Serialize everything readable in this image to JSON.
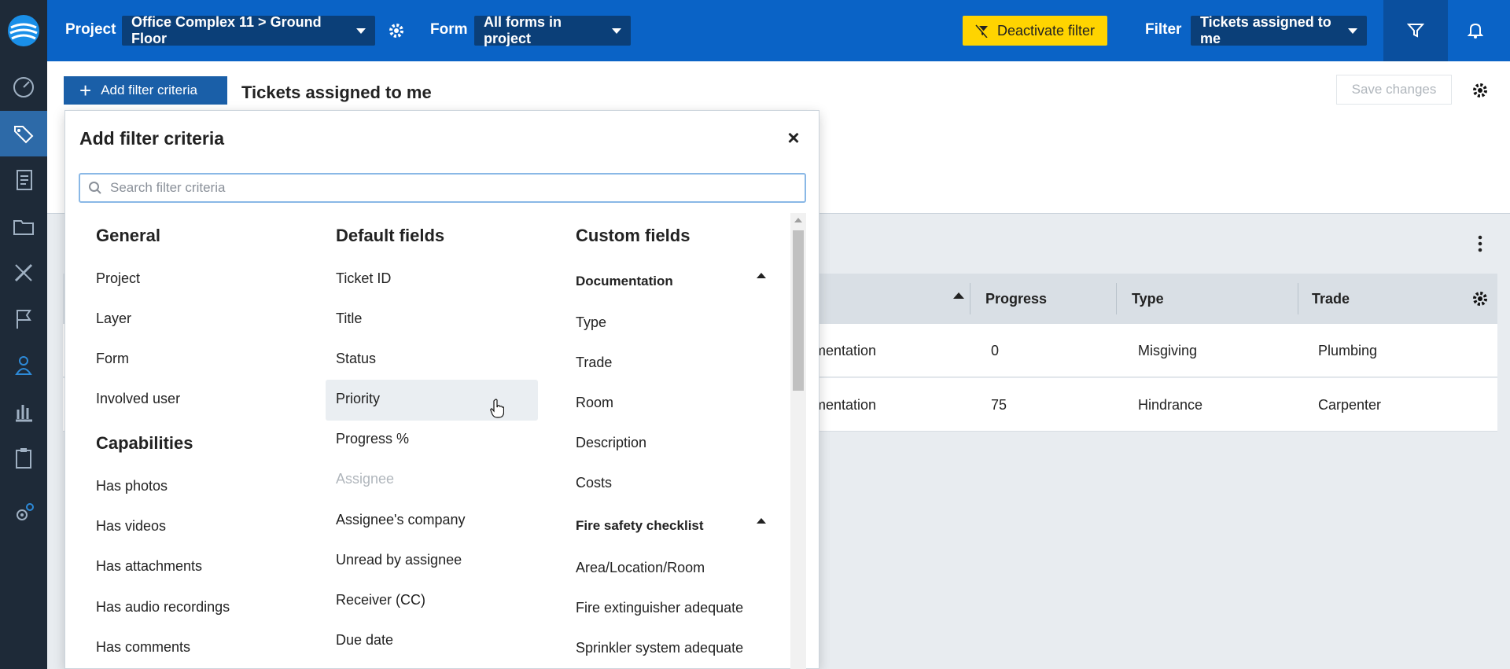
{
  "topbar": {
    "project_label": "Project",
    "project_value": "Office Complex 11 > Ground Floor",
    "form_label": "Form",
    "form_value": "All forms in project",
    "deactivate_label": "Deactivate filter",
    "filter_label": "Filter",
    "filter_value": "Tickets assigned to me"
  },
  "header": {
    "add_filter_label": "Add filter criteria",
    "title": "Tickets assigned to me",
    "save_label": "Save changes"
  },
  "table": {
    "headers": [
      "Progress",
      "Type",
      "Trade"
    ],
    "rows": [
      {
        "partial": "mentation",
        "progress": "0",
        "type": "Misgiving",
        "trade": "Plumbing"
      },
      {
        "partial": "mentation",
        "progress": "75",
        "type": "Hindrance",
        "trade": "Carpenter"
      }
    ]
  },
  "popup": {
    "title": "Add filter criteria",
    "close_glyph": "×",
    "search_placeholder": "Search filter criteria",
    "general": {
      "heading": "General",
      "items": [
        "Project",
        "Layer",
        "Form",
        "Involved user"
      ]
    },
    "capabilities": {
      "heading": "Capabilities",
      "items": [
        "Has photos",
        "Has videos",
        "Has attachments",
        "Has audio recordings",
        "Has comments"
      ]
    },
    "default_fields": {
      "heading": "Default fields",
      "items": [
        "Ticket ID",
        "Title",
        "Status",
        "Priority",
        "Progress %",
        "Assignee",
        "Assignee's company",
        "Unread by assignee",
        "Receiver (CC)",
        "Due date"
      ],
      "disabled_item": "Assignee",
      "hovered_item": "Priority"
    },
    "custom_fields": {
      "heading": "Custom fields",
      "groups": [
        {
          "name": "Documentation",
          "items": [
            "Type",
            "Trade",
            "Room",
            "Description",
            "Costs"
          ]
        },
        {
          "name": "Fire safety checklist",
          "items": [
            "Area/Location/Room",
            "Fire extinguisher adequate",
            "Sprinkler system adequate"
          ]
        }
      ]
    }
  },
  "colors": {
    "topbar_bg": "#0a63c6",
    "select_bg": "#0b3f78",
    "sidebar_bg": "#1e2a38",
    "accent_yellow": "#ffd400",
    "button_blue": "#1a5fa8"
  },
  "icons": {
    "sidebar": [
      "app-logo-icon",
      "dashboard-icon",
      "tickets-icon",
      "plans-icon",
      "folder-icon",
      "tools-icon",
      "flag-icon",
      "user-icon",
      "chart-icon",
      "clipboard-icon",
      "settings-icon"
    ]
  }
}
